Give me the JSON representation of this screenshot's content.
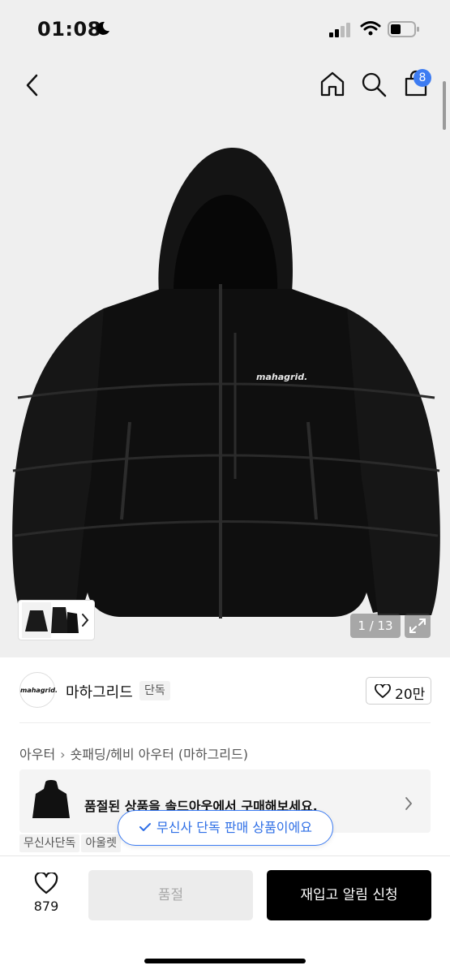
{
  "status_bar": {
    "time": "01:08"
  },
  "nav": {
    "cart_count": "8"
  },
  "gallery": {
    "counter": "1 / 13"
  },
  "brand": {
    "logo_text": "mahagrid.",
    "name": "마하그리드",
    "tag": "단독",
    "likes": "20만"
  },
  "breadcrumb": {
    "items": [
      "아우터",
      "숏패딩/헤비 아우터 (마하그리드)"
    ]
  },
  "banner": {
    "text": "품절된 상품을 솔드아웃에서 구매해보세요."
  },
  "tags": [
    "무신사단독",
    "아울렛"
  ],
  "toast": {
    "text": "무신사 단독 판매 상품이에요"
  },
  "bottom": {
    "wish_count": "879",
    "soldout_label": "품절",
    "restock_label": "재입고 알림 신청"
  },
  "product_image": {
    "brand_print": "mahagrid."
  },
  "colors": {
    "accent": "#3d7cf2",
    "primary_button": "#000000"
  }
}
